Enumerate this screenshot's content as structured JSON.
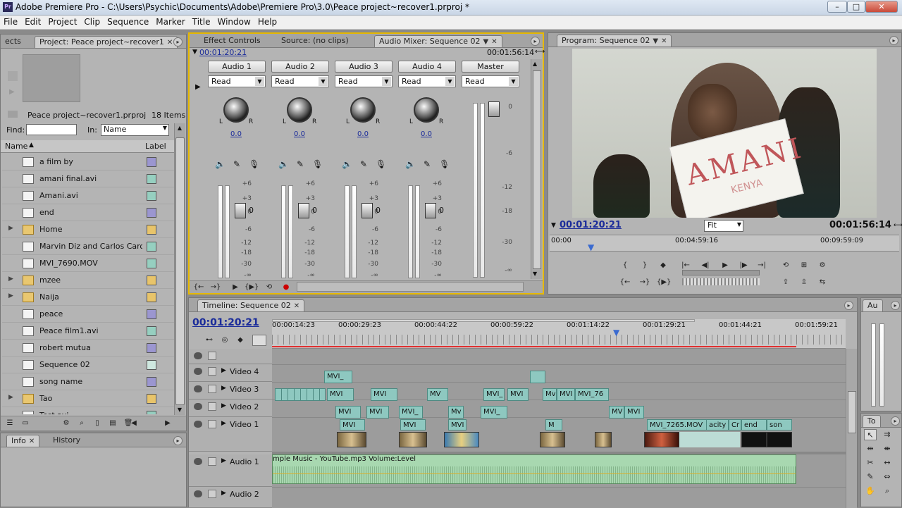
{
  "window": {
    "title": "Adobe Premiere Pro - C:\\Users\\Psychic\\Documents\\Adobe\\Premiere Pro\\3.0\\Peace project~recover1.prproj *",
    "logo": "Pr",
    "minimize": "–",
    "maximize": "□",
    "close": "✕"
  },
  "menu": [
    "File",
    "Edit",
    "Project",
    "Clip",
    "Sequence",
    "Marker",
    "Title",
    "Window",
    "Help"
  ],
  "project_panel": {
    "tab_prev": "ects",
    "tab": "Project: Peace project~recover1",
    "filename": "Peace project~recover1.prproj",
    "items_count": "18 Items",
    "find_label": "Find:",
    "find_value": "",
    "in_label": "In:",
    "in_value": "Name",
    "col_name": "Name",
    "col_label": "Label",
    "items": [
      {
        "name": "a film by",
        "icon": "title-icon",
        "folder": false,
        "color": "#9b96d0"
      },
      {
        "name": "amani final.avi",
        "icon": "movie-icon",
        "folder": false,
        "color": "#96cfc0"
      },
      {
        "name": "Amani.avi",
        "icon": "movie-icon",
        "folder": false,
        "color": "#96cfc0"
      },
      {
        "name": "end",
        "icon": "title-icon",
        "folder": false,
        "color": "#9b96d0"
      },
      {
        "name": "Home",
        "icon": "folder-icon",
        "folder": true,
        "color": "#e8c46a"
      },
      {
        "name": "Marvin Diz and Carlos Caro -",
        "icon": "audio-icon",
        "folder": false,
        "color": "#96cfc0"
      },
      {
        "name": "MVI_7690.MOV",
        "icon": "movie-icon",
        "folder": false,
        "color": "#96cfc0"
      },
      {
        "name": "mzee",
        "icon": "folder-icon",
        "folder": true,
        "color": "#e8c46a"
      },
      {
        "name": "Naija",
        "icon": "folder-icon",
        "folder": true,
        "color": "#e8c46a"
      },
      {
        "name": "peace",
        "icon": "title-icon",
        "folder": false,
        "color": "#9b96d0"
      },
      {
        "name": "Peace film1.avi",
        "icon": "movie-icon",
        "folder": false,
        "color": "#96cfc0"
      },
      {
        "name": "robert mutua",
        "icon": "title-icon",
        "folder": false,
        "color": "#9b96d0"
      },
      {
        "name": "Sequence 02",
        "icon": "sequence-icon",
        "folder": false,
        "color": "#cfe8e0"
      },
      {
        "name": "song name",
        "icon": "title-icon",
        "folder": false,
        "color": "#9b96d0"
      },
      {
        "name": "Tao",
        "icon": "folder-icon",
        "folder": true,
        "color": "#e8c46a"
      },
      {
        "name": "Test.avi",
        "icon": "movie-icon",
        "folder": false,
        "color": "#96cfc0"
      }
    ]
  },
  "info_panel": {
    "tab_info": "Info",
    "tab_history": "History"
  },
  "mixer_panel": {
    "tabs": [
      "Effect Controls",
      "Source: (no clips)",
      "Audio Mixer: Sequence 02"
    ],
    "time_left": "00:01:20:21",
    "time_right": "00:01:56:14",
    "channels": [
      {
        "name": "Audio 1",
        "mode": "Read",
        "pan": "0.0"
      },
      {
        "name": "Audio 2",
        "mode": "Read",
        "pan": "0.0"
      },
      {
        "name": "Audio 3",
        "mode": "Read",
        "pan": "0.0"
      },
      {
        "name": "Audio 4",
        "mode": "Read",
        "pan": "0.0"
      }
    ],
    "master": {
      "name": "Master",
      "mode": "Read"
    },
    "knob_l": "L",
    "knob_r": "R",
    "scale": [
      "+6",
      "+3",
      "0",
      "-6",
      "-12",
      "-18",
      "-30",
      "-∞"
    ],
    "master_scale": [
      "0",
      "-6",
      "-12",
      "-18",
      "-30",
      "-∞"
    ],
    "fader_db": "0"
  },
  "program_panel": {
    "tab": "Program: Sequence 02",
    "current_time": "00:01:20:21",
    "fit": "Fit",
    "duration": "00:01:56:14",
    "ruler": [
      "00:00",
      "00:04:59:16",
      "00:09:59:09"
    ],
    "sign_text": "AMANI",
    "sign_sub": "KENYA"
  },
  "timeline_panel": {
    "tab": "Timeline: Sequence 02",
    "current_time": "00:01:20:21",
    "ruler": [
      "00:00:14:23",
      "00:00:29:23",
      "00:00:44:22",
      "00:00:59:22",
      "00:01:14:22",
      "00:01:29:21",
      "00:01:44:21",
      "00:01:59:21"
    ],
    "tracks": [
      "Video 4",
      "Video 3",
      "Video 2",
      "Video 1",
      "Audio 1",
      "Audio 2"
    ],
    "audio_clip": "mple Music - YouTube.mp3  Volume:Level",
    "clips_v4": [
      "MVI_"
    ],
    "clips_v3": [
      "MVI",
      "MVI",
      "MV",
      "MVI_",
      "MVI",
      "Mv",
      "MVI",
      "MVI_76"
    ],
    "clips_v2": [
      "MVI",
      "MVI",
      "MVI_",
      "Mv",
      "MVI_",
      "MV",
      "MVI"
    ],
    "clips_v1": [
      "MVI",
      "MVI",
      "MVI",
      "M",
      "MVI_7265.MOV",
      "acity",
      "Cr",
      "end",
      "son"
    ]
  },
  "side_panels": {
    "audio_master_tab": "Au",
    "tools_tab": "To"
  }
}
